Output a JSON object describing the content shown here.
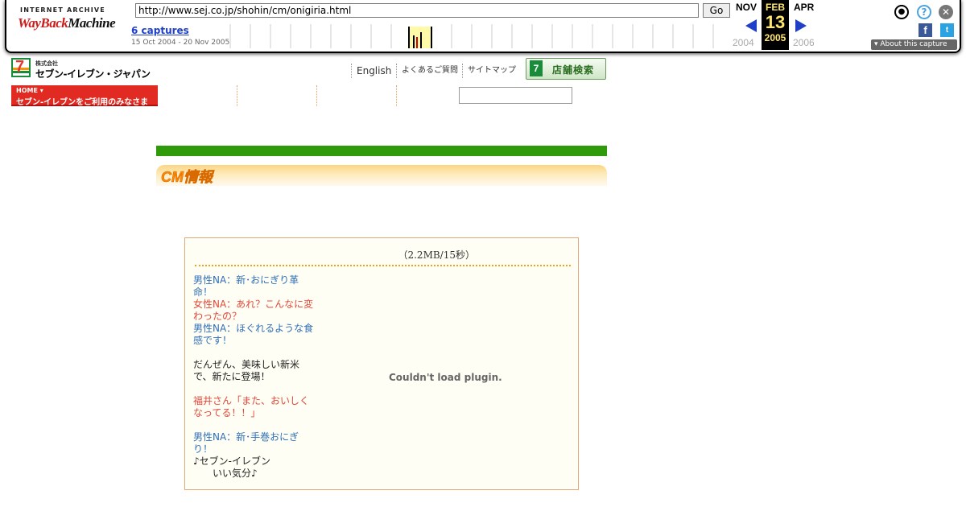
{
  "wayback": {
    "logo_top": "INTERNET ARCHIVE",
    "logo_wayback": "WayBack",
    "logo_machine": "Machine",
    "url": "http://www.sej.co.jp/shohin/cm/onigiria.html",
    "go_label": "Go",
    "captures": "6 captures",
    "range": "15 Oct 2004 - 20 Nov 2005",
    "prev_month": "NOV",
    "cur_month": "FEB",
    "cur_day": "13",
    "cur_year": "2005",
    "next_month": "APR",
    "prev_year": "2004",
    "next_year": "2006",
    "about": "About this capture",
    "icons": [
      "user-icon",
      "help-icon",
      "close-icon",
      "facebook-icon",
      "twitter-icon"
    ]
  },
  "header": {
    "logo_small": "株式会社",
    "logo_name": "セブン-イレブン・ジャパン",
    "links": [
      "English",
      "よくあるご質問",
      "サイトマップ"
    ],
    "store_search": "店舗検索",
    "home_tab_top": "HOME ▾",
    "home_tab_label": "セブン-イレブンをご利用のみなさま"
  },
  "content": {
    "section_title": "CM情報",
    "file_size": "（2.2MB/15秒）",
    "script": [
      {
        "text": "男性NA：新･おにぎり革命！",
        "color": "blue"
      },
      {
        "text": "女性NA：あれ？こんなに変わったの？",
        "color": "red"
      },
      {
        "text": "男性NA：ほぐれるような食感です！",
        "color": "blue"
      },
      {
        "text": "",
        "color": "gap"
      },
      {
        "text": "だんぜん、美味しい新米で、新たに登場！",
        "color": "black"
      },
      {
        "text": "",
        "color": "gap"
      },
      {
        "text": "福井さん「また、おいしくなってる！！」",
        "color": "red"
      },
      {
        "text": "",
        "color": "gap"
      },
      {
        "text": "男性NA：新･手巻おにぎり！",
        "color": "blue"
      },
      {
        "text": "♪セブン-イレブン",
        "color": "black"
      },
      {
        "text": "　　いい気分♪",
        "color": "black"
      }
    ],
    "plugin_message": "Couldn't load plugin."
  }
}
